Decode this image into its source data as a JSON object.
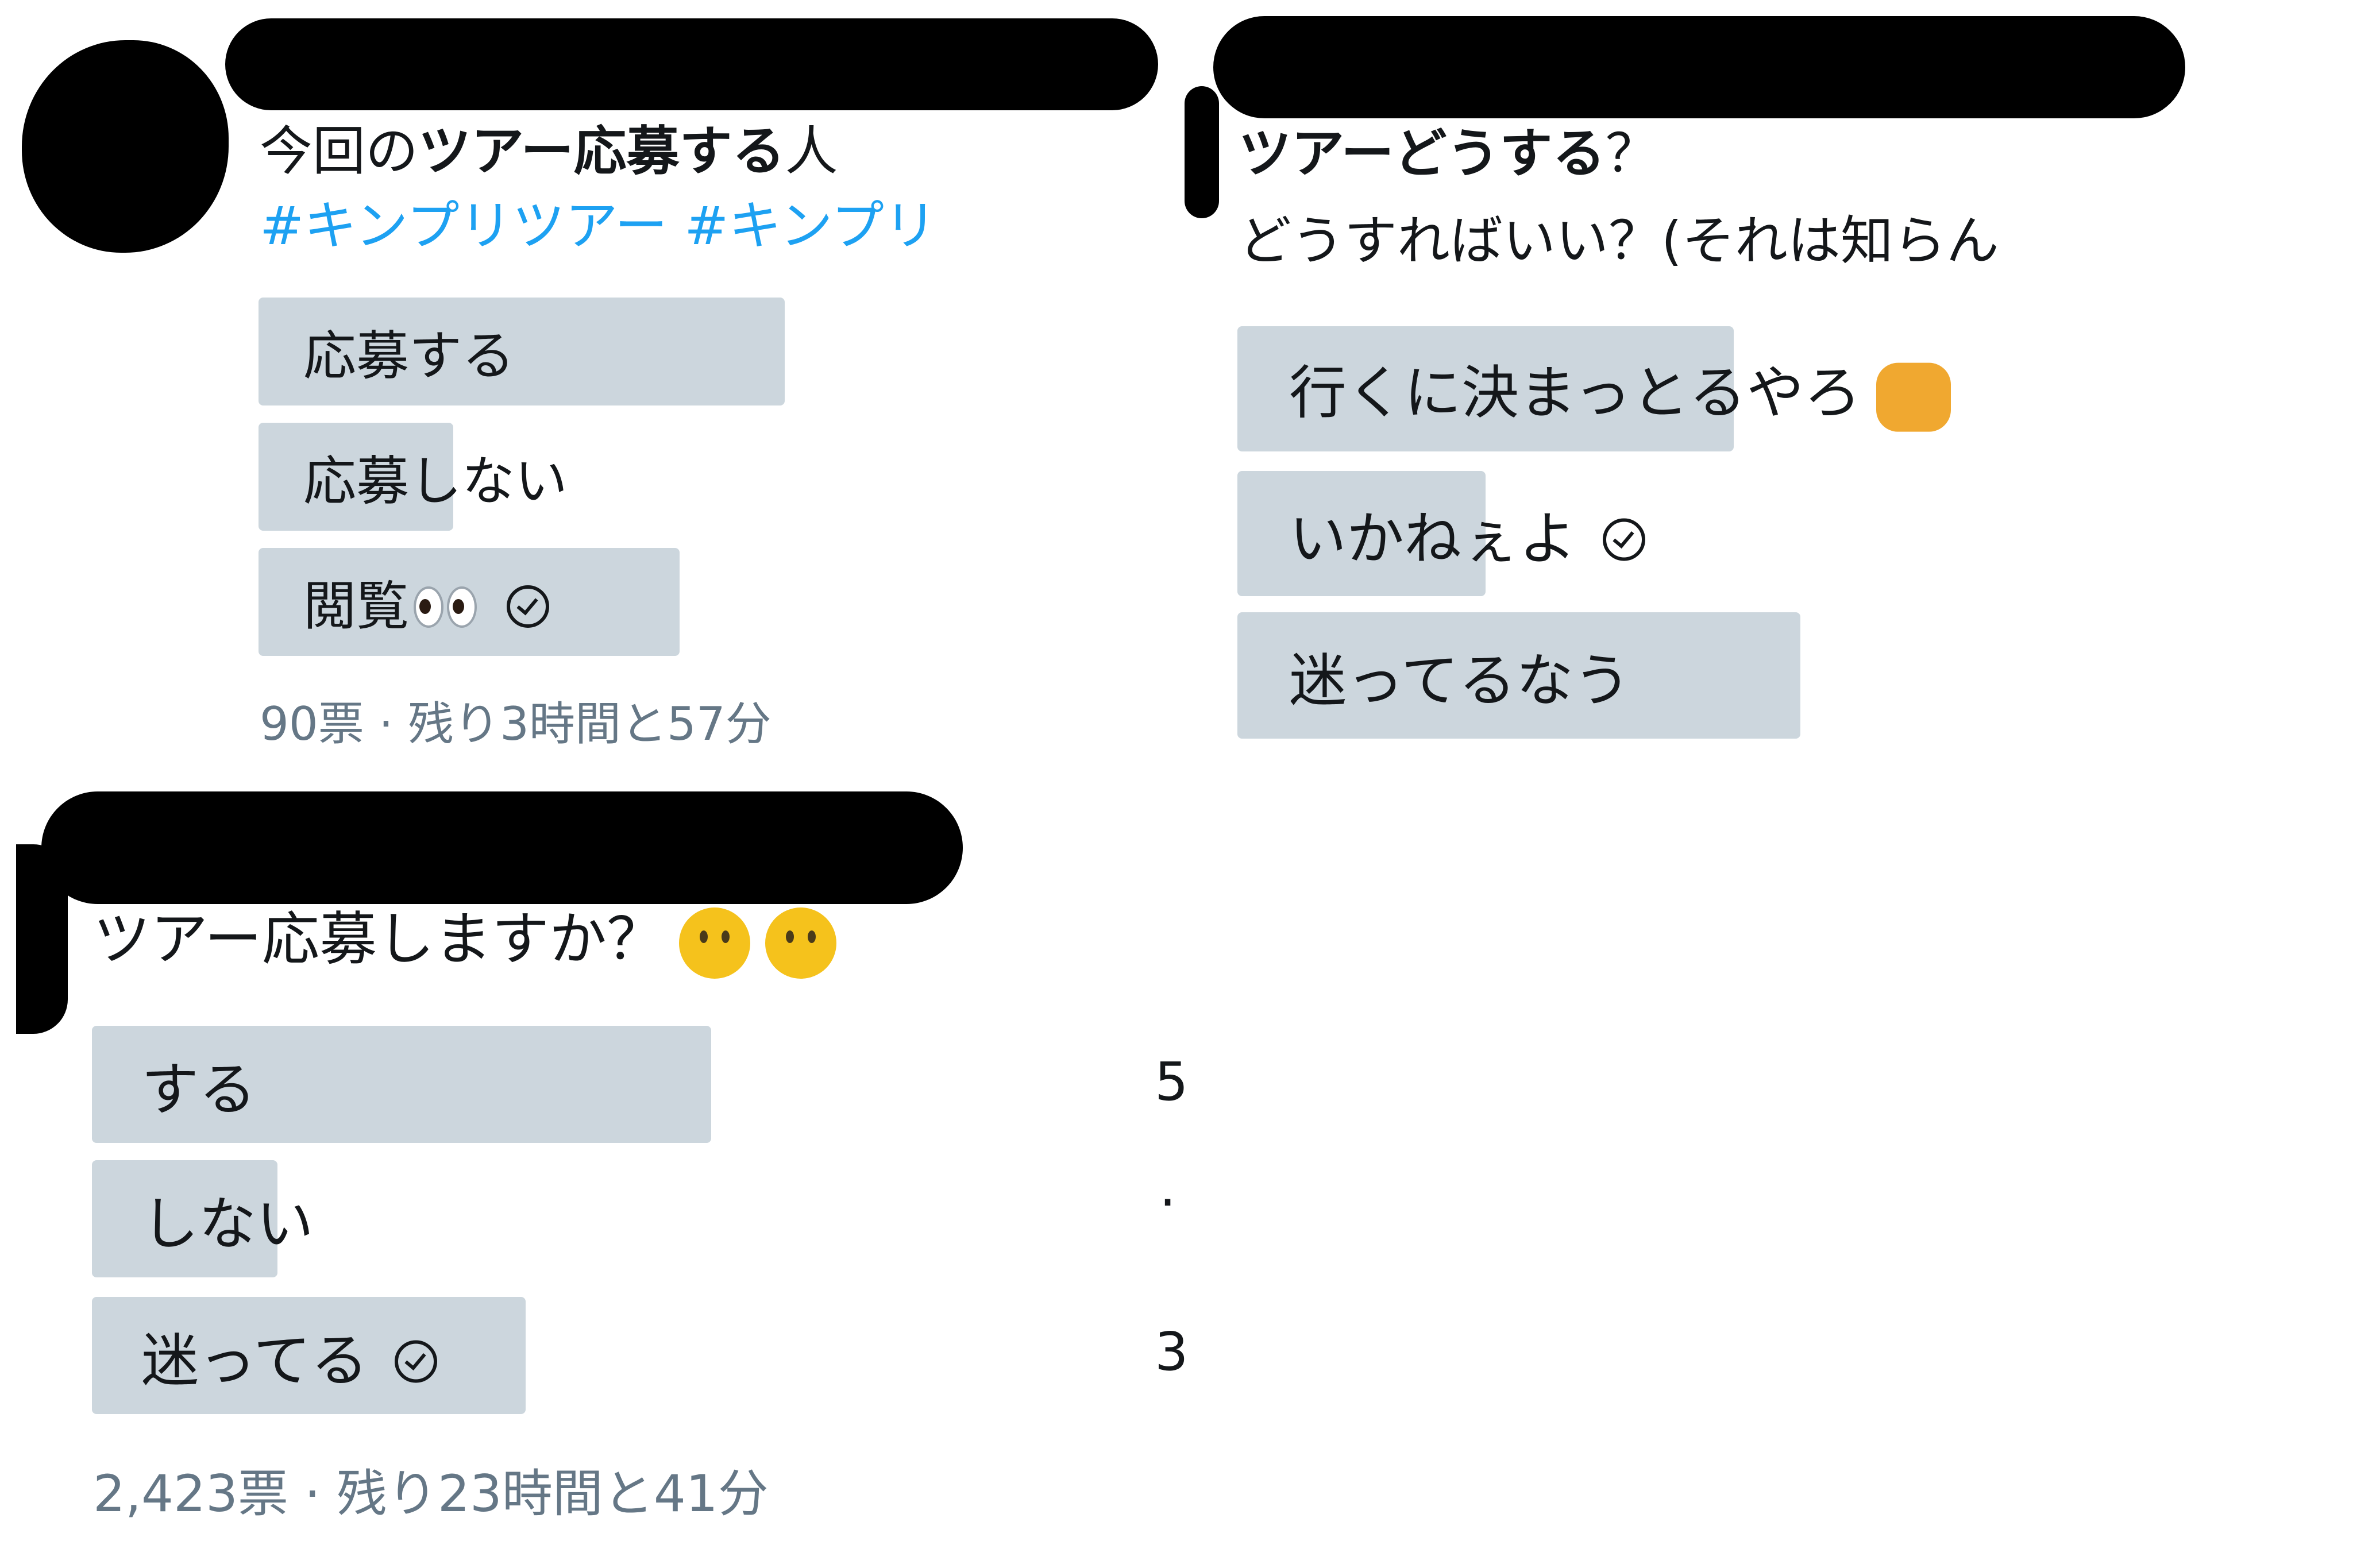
{
  "poll1": {
    "line1_plain": "今回の",
    "line1_bold": "ツアー応募する",
    "line1_end": "人",
    "hashtags": "#キンプリツアー #キンプリ",
    "options": [
      {
        "label": "応募する",
        "percent": 100
      },
      {
        "label": "応募しない",
        "percent": 37
      },
      {
        "label": "閲覧",
        "percent": 80,
        "selected": true
      }
    ],
    "meta": "90票 · 残り3時間と57分"
  },
  "poll2": {
    "question_bold": "ツアーどうする",
    "question_end": "？",
    "line2": "どうすればいい？(それは知らん",
    "options": [
      {
        "label": "行くに決まっとるやろ",
        "percent": 100
      },
      {
        "label": "いかねぇよ",
        "percent": 50,
        "selected": true
      },
      {
        "label": "迷ってるなう",
        "percent": 100
      }
    ]
  },
  "poll3": {
    "question": "ツアー応募しますか？",
    "options": [
      {
        "label": "する",
        "percent": 100
      },
      {
        "label": "しない",
        "percent": 30
      },
      {
        "label": "迷ってる",
        "percent": 70,
        "selected": true
      }
    ],
    "meta": "2,423票 · 残り23時間と41分"
  },
  "colors": {
    "bar": "#ccd6dd",
    "hashtag": "#1da1f2",
    "meta": "#657786"
  },
  "icons": [
    "eyes-emoji-icon",
    "fist-emoji-icon",
    "thinking-face-emoji-icon",
    "check-circle-icon"
  ],
  "edge_marks": [
    "5",
    "·",
    "3"
  ]
}
